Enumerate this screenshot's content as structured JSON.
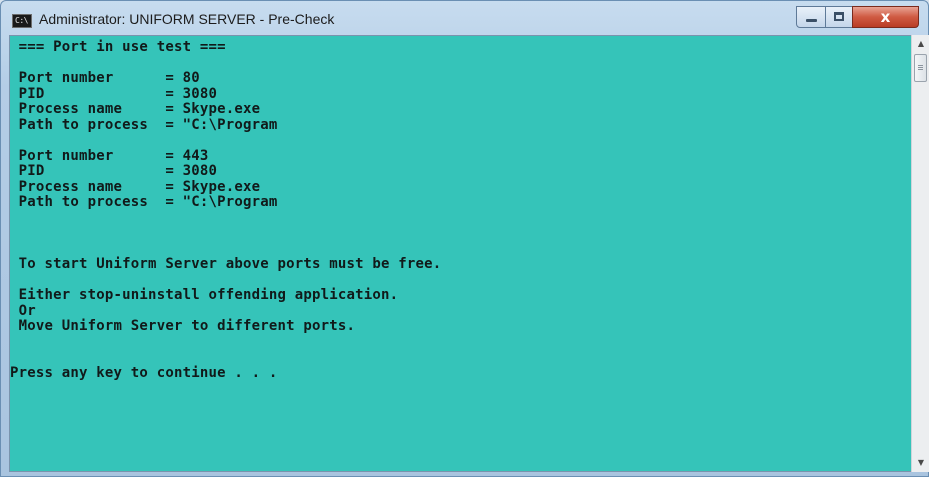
{
  "window": {
    "title": "Administrator: UNIFORM SERVER - Pre-Check",
    "icon": "console-icon",
    "icon_label": "C:\\",
    "buttons": {
      "minimize": "minimize-icon",
      "maximize": "maximize-icon",
      "close_glyph": "x"
    },
    "colors": {
      "console_bg": "#35c4b9",
      "console_text": "#111a1a",
      "close_button": "#c8513a"
    }
  },
  "console": {
    "lines": [
      " === Port in use test ===",
      "",
      " Port number      = 80",
      " PID              = 3080",
      " Process name     = Skype.exe",
      " Path to process  = \"C:\\Program",
      "",
      " Port number      = 443",
      " PID              = 3080",
      " Process name     = Skype.exe",
      " Path to process  = \"C:\\Program",
      "",
      "",
      "",
      " To start Uniform Server above ports must be free.",
      "",
      " Either stop-uninstall offending application.",
      " Or",
      " Move Uniform Server to different ports.",
      "",
      "",
      "Press any key to continue . . ."
    ]
  },
  "scrollbar": {
    "up": "▲",
    "down": "▼"
  }
}
